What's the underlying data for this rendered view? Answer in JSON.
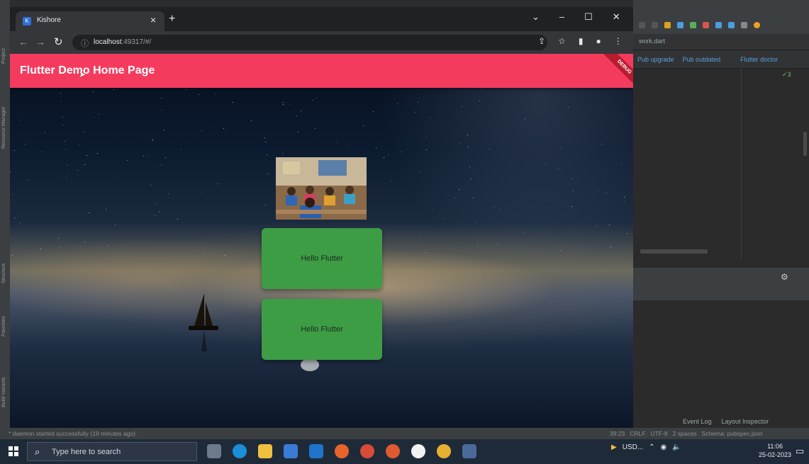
{
  "browser": {
    "tab_title": "Kishore",
    "favicon_letter": "K",
    "tab_close": "×",
    "new_tab": "+",
    "window_controls": [
      "⌄",
      "–",
      "☐",
      "✕"
    ],
    "url_host": "localhost",
    "url_path": ":49317/#/"
  },
  "app": {
    "appbar_title": "Flutter Demo Home Page",
    "debug_banner": "DEBUG",
    "cards": [
      {
        "label": "Hello Flutter"
      },
      {
        "label": "Hello Flutter"
      }
    ]
  },
  "ide": {
    "tab": "work.dart",
    "actions": [
      "Pub upgrade",
      "Pub outdated",
      "Flutter doctor"
    ],
    "check_count": "✓3",
    "bottom_links": [
      "Event Log",
      "Layout Inspector"
    ],
    "side_labels": [
      "Project",
      "Resource Manager",
      "Structure",
      "Favorites",
      "Build Variants"
    ]
  },
  "statusbar": {
    "message": "* daemon started successfully (19 minutes ago)",
    "position": "39:23",
    "line_ending": "CRLF",
    "encoding": "UTF-8",
    "indent": "2 spaces",
    "schema": "Schema: pubspec.json"
  },
  "taskbar": {
    "search_placeholder": "Type here to search",
    "tray_text": "USD...",
    "time": "11:06",
    "date": "25-02-2023"
  },
  "colors": {
    "appbar": "#f43b5e",
    "card": "#3d9d45"
  }
}
